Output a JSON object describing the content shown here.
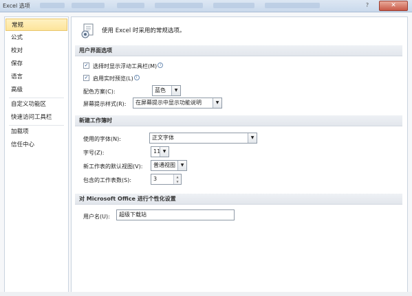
{
  "window": {
    "title": "Excel 选项",
    "help_label": "?",
    "close_label": "✕"
  },
  "sidebar": {
    "items": [
      {
        "label": "常规",
        "active": true
      },
      {
        "label": "公式"
      },
      {
        "label": "校对"
      },
      {
        "label": "保存"
      },
      {
        "label": "语言"
      },
      {
        "label": "高级"
      },
      {
        "label": "自定义功能区"
      },
      {
        "label": "快速访问工具栏"
      },
      {
        "label": "加载项"
      },
      {
        "label": "信任中心"
      }
    ]
  },
  "main": {
    "intro": "使用 Excel 时采用的常规选项。",
    "ui_section": {
      "heading": "用户界面选项",
      "mini_toolbar_label": "选择时显示浮动工具栏(M)",
      "mini_toolbar_checked": true,
      "live_preview_label": "启用实时预览(L)",
      "live_preview_checked": true,
      "color_scheme_label": "配色方案(C):",
      "color_scheme_value": "蓝色",
      "screentip_label": "屏幕提示样式(R):",
      "screentip_value": "在屏幕提示中显示功能说明"
    },
    "workbook_section": {
      "heading": "新建工作簿时",
      "font_label": "使用的字体(N):",
      "font_value": "正文字体",
      "size_label": "字号(Z):",
      "size_value": "11",
      "view_label": "新工作表的默认视图(V):",
      "view_value": "普通视图",
      "sheets_label": "包含的工作表数(S):",
      "sheets_value": "3"
    },
    "personalize_section": {
      "heading": "对 Microsoft Office 进行个性化设置",
      "username_label": "用户名(U):",
      "username_value": "超级下载站"
    }
  },
  "colors": {
    "active_item": "#fde49a",
    "section_header": "#e6eaef",
    "titlebar": "#c9d9ec"
  }
}
